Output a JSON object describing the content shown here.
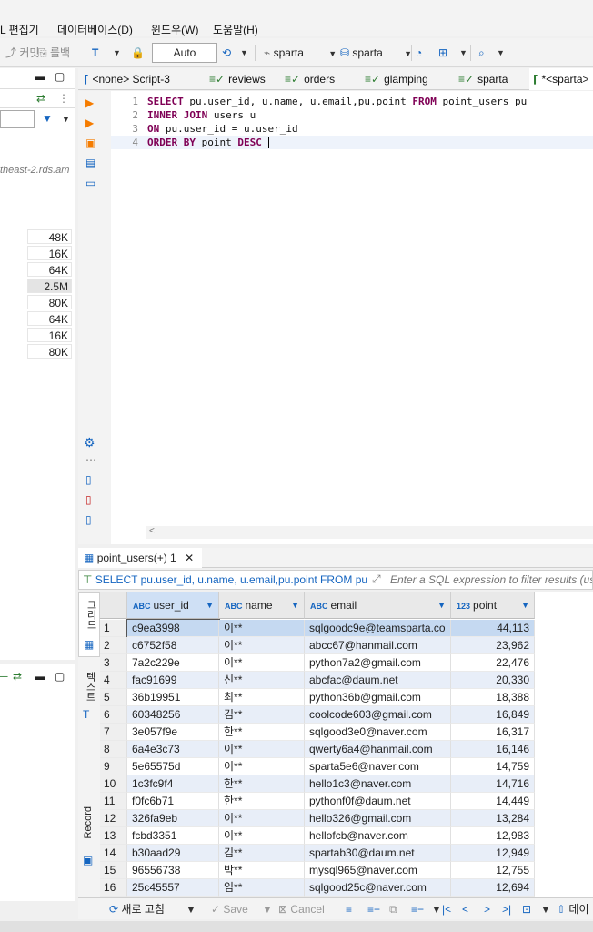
{
  "menu": [
    "L 편집기",
    "데이터베이스(D)",
    "윈도우(W)",
    "도움말(H)"
  ],
  "toolbar": {
    "commit": "커밋",
    "rollback": "롤백",
    "autocommit": "Auto",
    "datasource": "sparta",
    "schema": "sparta"
  },
  "left_panel": {
    "host_fragment": "theast-2.rds.am",
    "sizes": [
      "48K",
      "16K",
      "64K",
      "2.5M",
      "80K",
      "64K",
      "16K",
      "80K"
    ]
  },
  "editor_tabs": [
    "<none> Script-3",
    "reviews",
    "orders",
    "glamping",
    "sparta",
    "*<sparta>"
  ],
  "sql_lines": [
    {
      "n": "1",
      "parts": [
        {
          "t": "SELECT",
          "k": true
        },
        {
          "t": " pu.user_id, u.name, u.email,pu.point ",
          "k": false
        },
        {
          "t": "FROM",
          "k": true
        },
        {
          "t": " point_users pu",
          "k": false
        }
      ]
    },
    {
      "n": "2",
      "parts": [
        {
          "t": "INNER JOIN",
          "k": true
        },
        {
          "t": " users u",
          "k": false
        }
      ]
    },
    {
      "n": "3",
      "parts": [
        {
          "t": "ON",
          "k": true
        },
        {
          "t": " pu.user_id = u.user_id",
          "k": false
        }
      ]
    },
    {
      "n": "4",
      "parts": [
        {
          "t": "ORDER BY",
          "k": true
        },
        {
          "t": " point ",
          "k": false
        },
        {
          "t": "DESC",
          "k": true
        },
        {
          "t": " ",
          "k": false
        }
      ]
    }
  ],
  "result_tab": "point_users(+) 1",
  "filter": {
    "query": "SELECT pu.user_id, u.name, u.email,pu.point FROM pu",
    "placeholder": "Enter a SQL expression to filter results (us"
  },
  "vtabs": [
    "그리드",
    "텍스트",
    "Record"
  ],
  "columns": [
    {
      "type": "ABC",
      "name": "user_id"
    },
    {
      "type": "ABC",
      "name": "name"
    },
    {
      "type": "ABC",
      "name": "email"
    },
    {
      "type": "123",
      "name": "point"
    }
  ],
  "rows": [
    [
      "1",
      "c9ea3998",
      "이**",
      "sqlgoodc9e@teamsparta.co",
      "44,113"
    ],
    [
      "2",
      "c6752f58",
      "이**",
      "abcc67@hanmail.com",
      "23,962"
    ],
    [
      "3",
      "7a2c229e",
      "이**",
      "python7a2@gmail.com",
      "22,476"
    ],
    [
      "4",
      "fac91699",
      "신**",
      "abcfac@daum.net",
      "20,330"
    ],
    [
      "5",
      "36b19951",
      "최**",
      "python36b@gmail.com",
      "18,388"
    ],
    [
      "6",
      "60348256",
      "김**",
      "coolcode603@gmail.com",
      "16,849"
    ],
    [
      "7",
      "3e057f9e",
      "한**",
      "sqlgood3e0@naver.com",
      "16,317"
    ],
    [
      "8",
      "6a4e3c73",
      "이**",
      "qwerty6a4@hanmail.com",
      "16,146"
    ],
    [
      "9",
      "5e65575d",
      "이**",
      "sparta5e6@naver.com",
      "14,759"
    ],
    [
      "10",
      "1c3fc9f4",
      "한**",
      "hello1c3@naver.com",
      "14,716"
    ],
    [
      "11",
      "f0fc6b71",
      "한**",
      "pythonf0f@daum.net",
      "14,449"
    ],
    [
      "12",
      "326fa9eb",
      "이**",
      "hello326@gmail.com",
      "13,284"
    ],
    [
      "13",
      "fcbd3351",
      "이**",
      "hellofcb@naver.com",
      "12,983"
    ],
    [
      "14",
      "b30aad29",
      "김**",
      "spartab30@daum.net",
      "12,949"
    ],
    [
      "15",
      "96556738",
      "박**",
      "mysql965@naver.com",
      "12,755"
    ],
    [
      "16",
      "25c45557",
      "임**",
      "sqlgood25c@naver.com",
      "12,694"
    ]
  ],
  "bottom": {
    "refresh": "새로 고침",
    "save": "Save",
    "cancel": "Cancel",
    "data": "데이"
  },
  "colors": {
    "keyword": "#7f0055",
    "accent": "#1565c0",
    "selected": "#c5d9f1",
    "alt_row": "#e8eef8"
  }
}
